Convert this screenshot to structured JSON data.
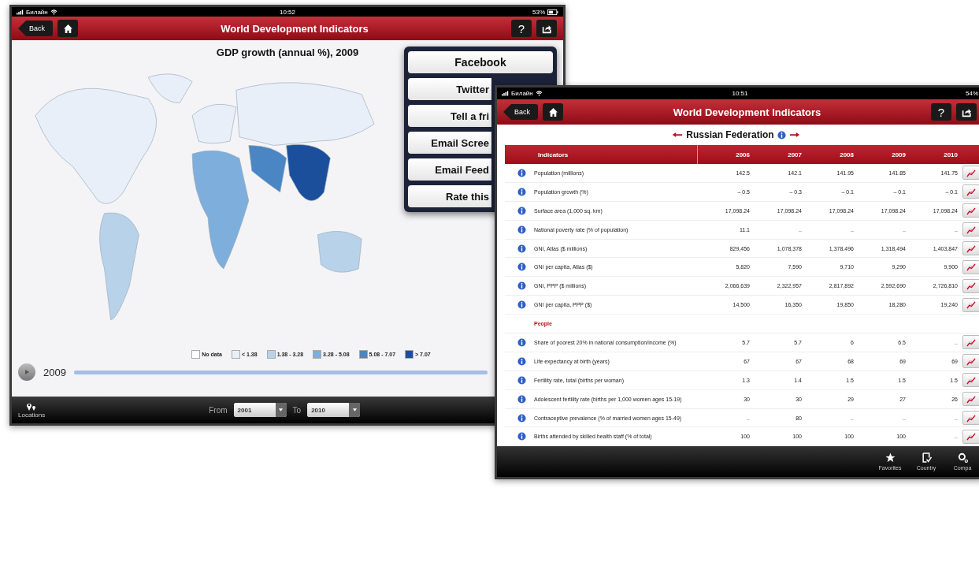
{
  "map_screen": {
    "status_bar": {
      "carrier": "Билайн",
      "time": "10:52",
      "battery": "53%"
    },
    "nav_bar": {
      "back": "Back",
      "title": "World Development Indicators",
      "help": "?"
    },
    "map_title": "GDP growth (annual %), 2009",
    "legend": [
      {
        "label": "No data",
        "color": "#ffffff"
      },
      {
        "label": "< 1.38",
        "color": "#e8eff8"
      },
      {
        "label": "1.38 - 3.28",
        "color": "#b8d2ea"
      },
      {
        "label": "3.28 - 5.08",
        "color": "#7eafdc"
      },
      {
        "label": "5.08 - 7.07",
        "color": "#4a86c3"
      },
      {
        "label": "> 7.07",
        "color": "#1b4f9c"
      }
    ],
    "year_slider": {
      "year": "2009",
      "level": 1
    },
    "bottom_bar": {
      "locations": "Locations",
      "from_label": "From",
      "from_value": "2001",
      "to_label": "To",
      "to_value": "2010"
    },
    "share_menu": [
      {
        "label": "Facebook",
        "kind": "full"
      },
      {
        "label": "Twitter",
        "kind": "cut"
      },
      {
        "label": "Tell a fri",
        "kind": "cut"
      },
      {
        "label": "Email Scree",
        "kind": "cut"
      },
      {
        "label": "Email Feed",
        "kind": "cut"
      },
      {
        "label": "Rate this",
        "kind": "cut"
      }
    ]
  },
  "table_screen": {
    "status_bar": {
      "carrier": "Билайн",
      "time": "10:51",
      "battery": "54%"
    },
    "nav_bar": {
      "back": "Back",
      "title": "World Development Indicators",
      "help": "?"
    },
    "country": "Russian Federation",
    "columns": [
      "Indicators",
      "2006",
      "2007",
      "2008",
      "2009",
      "2010"
    ],
    "rows": [
      {
        "kind": "indicator",
        "name": "Population (millions)",
        "values": [
          "142.5",
          "142.1",
          "141.95",
          "141.85",
          "141.75"
        ]
      },
      {
        "kind": "indicator",
        "name": "Population growth (%)",
        "values": [
          "– 0.5",
          "– 0.3",
          "– 0.1",
          "– 0.1",
          "– 0.1"
        ]
      },
      {
        "kind": "indicator",
        "name": "Surface area (1,000 sq. km)",
        "values": [
          "17,098.24",
          "17,098.24",
          "17,098.24",
          "17,098.24",
          "17,098.24"
        ]
      },
      {
        "kind": "indicator",
        "name": "National poverty rate (% of population)",
        "values": [
          "11.1",
          "..",
          "..",
          "..",
          ".."
        ]
      },
      {
        "kind": "indicator",
        "name": "GNI, Atlas ($ millions)",
        "values": [
          "829,456",
          "1,078,378",
          "1,378,496",
          "1,318,494",
          "1,403,847"
        ]
      },
      {
        "kind": "indicator",
        "name": "GNI per capita, Atlas ($)",
        "values": [
          "5,820",
          "7,590",
          "9,710",
          "9,290",
          "9,900"
        ]
      },
      {
        "kind": "indicator",
        "name": "GNI, PPP ($ millions)",
        "values": [
          "2,066,639",
          "2,322,957",
          "2,817,892",
          "2,592,690",
          "2,726,810"
        ]
      },
      {
        "kind": "indicator",
        "name": "GNI per capita, PPP ($)",
        "values": [
          "14,500",
          "16,350",
          "19,850",
          "18,280",
          "19,240"
        ]
      },
      {
        "kind": "section",
        "name": "People"
      },
      {
        "kind": "indicator",
        "name": "Share of poorest 20% in national consumption/income (%)",
        "values": [
          "5.7",
          "5.7",
          "6",
          "6.5",
          ".."
        ]
      },
      {
        "kind": "indicator",
        "name": "Life expectancy at birth (years)",
        "values": [
          "67",
          "67",
          "68",
          "69",
          "69"
        ]
      },
      {
        "kind": "indicator",
        "name": "Fertility rate, total (births per woman)",
        "values": [
          "1.3",
          "1.4",
          "1.5",
          "1.5",
          "1.5"
        ]
      },
      {
        "kind": "indicator",
        "name": "Adolescent fertility rate (births per 1,000 women ages 15-19)",
        "values": [
          "30",
          "30",
          "29",
          "27",
          "26"
        ]
      },
      {
        "kind": "indicator",
        "name": "Contraceptive prevalence (% of married women ages 15-49)",
        "values": [
          "..",
          "80",
          "..",
          "..",
          ".."
        ]
      },
      {
        "kind": "indicator",
        "name": "Births attended by skilled health staff (% of total)",
        "values": [
          "100",
          "100",
          "100",
          "100",
          ".."
        ]
      }
    ],
    "tab_bar": [
      "Favorites",
      "Country",
      "Compa"
    ]
  }
}
